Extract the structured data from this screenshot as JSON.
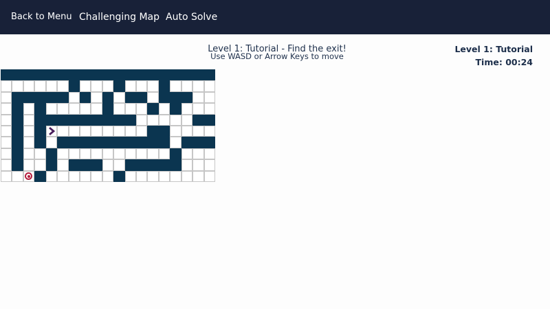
{
  "nav": {
    "back_label": "Back to Menu",
    "map_label": "Challenging Map",
    "auto_label": "Auto Solve"
  },
  "instructions": {
    "title": "Level 1: Tutorial - Find the exit!",
    "subtitle": "Use WASD or Arrow Keys to move"
  },
  "status": {
    "level": "Level 1: Tutorial",
    "time": "Time: 00:24"
  },
  "colors": {
    "topbar": "#182138",
    "wall": "#0b3550",
    "floor": "#ffffff",
    "player": "#4a1f5c",
    "goal": "#b41e3e",
    "text": "#1c2e4a"
  },
  "maze": {
    "cols": 19,
    "rows": 10,
    "cells": [
      "###################",
      "......#...#...#....",
      ".#####.#.#.##.###..",
      ".#.#.....#...#.#...",
      ".#.#########.....##",
      ".#.#.........##....",
      ".#.#.##########.###",
      ".#..#..........#...",
      ".#..#.###..#####...",
      "...#......#........"
    ],
    "player": {
      "row": 5,
      "col": 4,
      "icon": "chevron-right-icon"
    },
    "goal": {
      "row": 9,
      "col": 2,
      "icon": "target-icon"
    }
  }
}
